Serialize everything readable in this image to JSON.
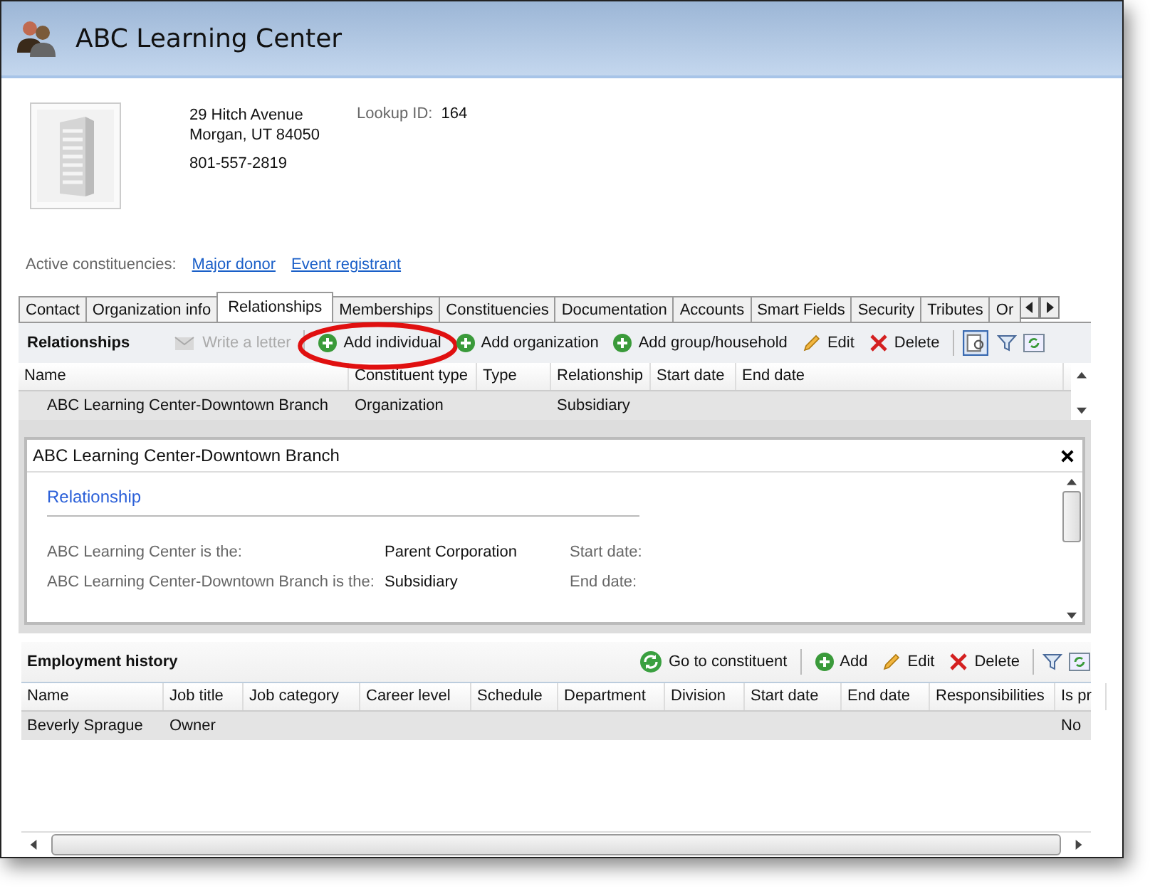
{
  "window": {
    "title": "ABC Learning Center"
  },
  "profile": {
    "address_line_1": "29 Hitch Avenue",
    "address_line_2": "Morgan, UT  84050",
    "phone": "801-557-2819",
    "lookup_label": "Lookup ID:",
    "lookup_id": "164"
  },
  "constituencies": {
    "label": "Active constituencies:",
    "links": [
      "Major donor",
      "Event registrant"
    ]
  },
  "tabs": [
    {
      "label": "Contact",
      "selected": false
    },
    {
      "label": "Organization info",
      "selected": false
    },
    {
      "label": "Relationships",
      "selected": true
    },
    {
      "label": "Memberships",
      "selected": false
    },
    {
      "label": "Constituencies",
      "selected": false
    },
    {
      "label": "Documentation",
      "selected": false
    },
    {
      "label": "Accounts",
      "selected": false
    },
    {
      "label": "Smart Fields",
      "selected": false
    },
    {
      "label": "Security",
      "selected": false
    },
    {
      "label": "Tributes",
      "selected": false
    },
    {
      "label": "Or",
      "selected": false
    }
  ],
  "relationships": {
    "title": "Relationships",
    "toolbar": [
      {
        "kind": "letter",
        "label": "Write a letter",
        "disabled": true,
        "highlighted": false
      },
      {
        "kind": "add",
        "label": "Add individual",
        "disabled": false,
        "highlighted": true
      },
      {
        "kind": "add",
        "label": "Add organization",
        "disabled": false,
        "highlighted": false
      },
      {
        "kind": "add",
        "label": "Add group/household",
        "disabled": false,
        "highlighted": false
      },
      {
        "kind": "edit",
        "label": "Edit",
        "disabled": false,
        "highlighted": false
      },
      {
        "kind": "delete",
        "label": "Delete",
        "disabled": false,
        "highlighted": false
      }
    ],
    "columns": [
      "Name",
      "Constituent type",
      "Type",
      "Relationship",
      "Start date",
      "End date"
    ],
    "rows": [
      {
        "cells": [
          "ABC Learning Center-Downtown Branch",
          "Organization",
          "",
          "Subsidiary",
          "",
          ""
        ],
        "selected": true
      }
    ]
  },
  "detail": {
    "title": "ABC Learning Center-Downtown Branch",
    "section": "Relationship",
    "fields": [
      {
        "label": "ABC Learning Center is the:",
        "value": "Parent Corporation",
        "date_label": "Start date:"
      },
      {
        "label": "ABC Learning Center-Downtown Branch is the:",
        "value": "Subsidiary",
        "date_label": "End date:"
      }
    ]
  },
  "employment": {
    "title": "Employment history",
    "toolbar": [
      {
        "kind": "goto",
        "label": "Go to constituent"
      },
      {
        "kind": "add",
        "label": "Add"
      },
      {
        "kind": "edit",
        "label": "Edit"
      },
      {
        "kind": "delete",
        "label": "Delete"
      }
    ],
    "columns": [
      "Name",
      "Job title",
      "Job category",
      "Career level",
      "Schedule",
      "Department",
      "Division",
      "Start date",
      "End date",
      "Responsibilities",
      "Is pr"
    ],
    "rows": [
      {
        "cells": [
          "Beverly Sprague",
          "Owner",
          "",
          "",
          "",
          "",
          "",
          "",
          "",
          "",
          "No"
        ],
        "selected": true
      }
    ]
  }
}
